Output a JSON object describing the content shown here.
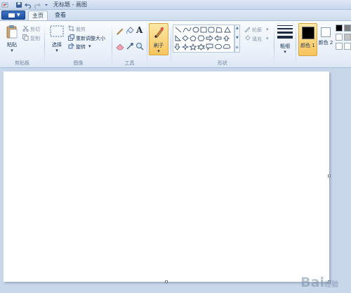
{
  "window": {
    "title": "无标题 - 画图"
  },
  "tabs": [
    {
      "label": "主页",
      "active": true
    },
    {
      "label": "查看",
      "active": false
    }
  ],
  "clipboard": {
    "paste_label": "粘贴",
    "cut_label": "剪切",
    "copy_label": "复制",
    "group_label": "剪贴板"
  },
  "image": {
    "select_label": "选择",
    "crop_label": "裁剪",
    "resize_label": "重新调整大小",
    "rotate_label": "旋转",
    "group_label": "图像"
  },
  "tools": {
    "group_label": "工具",
    "text_tool_glyph": "A"
  },
  "brush": {
    "label": "刷子"
  },
  "shapes": {
    "outline_label": "轮廓",
    "fill_label": "填充",
    "group_label": "形状"
  },
  "size": {
    "label": "粗细"
  },
  "colors": {
    "color1_label": "颜色 1",
    "color2_label": "颜色 2",
    "color1": "#000000",
    "color2": "#ffffff"
  },
  "watermark": {
    "text": "Bai",
    "suffix": "经验"
  }
}
